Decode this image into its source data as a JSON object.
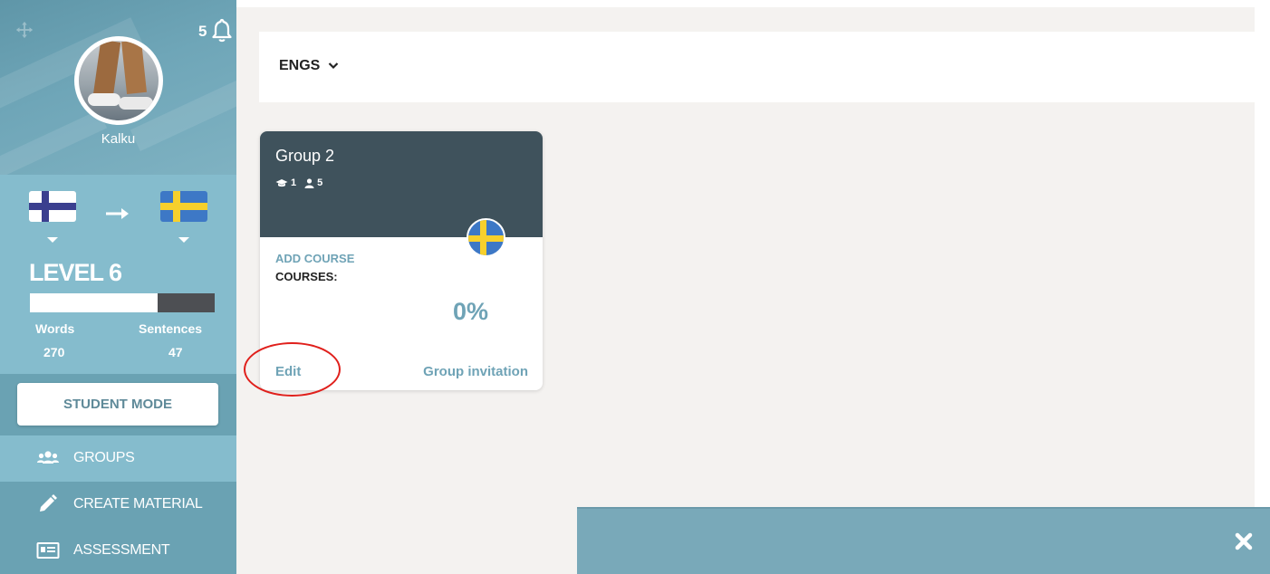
{
  "sidebar": {
    "notification_count": "5",
    "username": "Kalku",
    "from_language": "Finnish",
    "to_language": "Swedish",
    "level": "LEVEL 6",
    "level_progress": 0.69,
    "stats": {
      "words_label": "Words",
      "words_value": "270",
      "sentences_label": "Sentences",
      "sentences_value": "47"
    },
    "mode_button": "STUDENT MODE",
    "nav": [
      {
        "label": "GROUPS",
        "icon": "users-icon"
      },
      {
        "label": "CREATE MATERIAL",
        "icon": "pencil-icon"
      },
      {
        "label": "ASSESSMENT",
        "icon": "id-card-icon"
      }
    ]
  },
  "main": {
    "group_selector": "ENGS",
    "card": {
      "title": "Group 2",
      "teachers_count": "1",
      "students_count": "5",
      "add_course": "ADD COURSE",
      "courses_label": "COURSES:",
      "progress": "0%",
      "edit": "Edit",
      "invite": "Group invitation",
      "flag": "Swedish"
    }
  },
  "colors": {
    "sidebar": "#85bccd",
    "sidebar_dark": "#6aa2b3",
    "card_header": "#3f525c",
    "accent_text": "#6fa3b6",
    "annotation": "#e0201c"
  }
}
